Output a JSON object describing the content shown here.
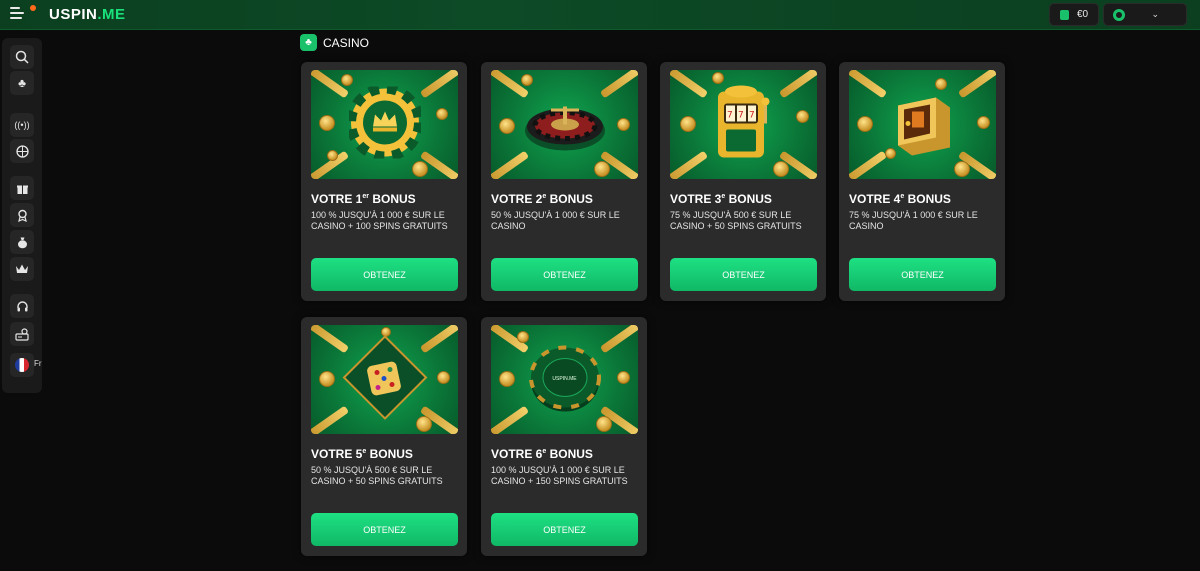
{
  "header": {
    "logo_main": "USPIN",
    "logo_accent": ".ME",
    "balance": "€0",
    "icons": {
      "menu": "hamburger-icon",
      "wallet": "wallet-icon",
      "profile": "user-icon",
      "chevron": "chevron-down-icon"
    }
  },
  "sidebar": {
    "icons": [
      "search-icon",
      "club-icon",
      "broadcast-icon",
      "basketball-icon",
      "gift-icon",
      "medal-icon",
      "money-bag-icon",
      "crown-icon",
      "headset-icon",
      "cashier-icon"
    ],
    "language_label": "Fr"
  },
  "section": {
    "title": "CASINO",
    "icon": "club-icon"
  },
  "cards": [
    {
      "title_prefix": "VOTRE 1",
      "title_sup": "er",
      "title_suffix": " BONUS",
      "description": "100 % JUSQU'À 1 000 € SUR LE CASINO + 100 SPINS GRATUITS",
      "button": "OBTENEZ",
      "image": "chip-crown"
    },
    {
      "title_prefix": "VOTRE 2",
      "title_sup": "e",
      "title_suffix": " BONUS",
      "description": "50 % JUSQU'À 1 000 € SUR LE CASINO",
      "button": "OBTENEZ",
      "image": "roulette"
    },
    {
      "title_prefix": "VOTRE 3",
      "title_sup": "e",
      "title_suffix": " BONUS",
      "description": "75 % JUSQU'À 500 € SUR LE CASINO + 50 SPINS GRATUITS",
      "button": "OBTENEZ",
      "image": "slot-machine"
    },
    {
      "title_prefix": "VOTRE 4",
      "title_sup": "e",
      "title_suffix": " BONUS",
      "description": "75 % JUSQU'À 1 000 € SUR LE CASINO",
      "button": "OBTENEZ",
      "image": "safe"
    },
    {
      "title_prefix": "VOTRE 5",
      "title_sup": "e",
      "title_suffix": " BONUS",
      "description": "50 % JUSQU'À 500 € SUR LE CASINO + 50 SPINS GRATUITS",
      "button": "OBTENEZ",
      "image": "dice"
    },
    {
      "title_prefix": "VOTRE 6",
      "title_sup": "e",
      "title_suffix": " BONUS",
      "description": "100 % JUSQU'À 1 000 € SUR LE CASINO + 150 SPINS GRATUITS",
      "button": "OBTENEZ",
      "image": "chip-logo",
      "image_text": "USPIN.ME"
    }
  ],
  "colors": {
    "accent": "#19c26a",
    "button": "#16d074",
    "card_bg": "#2b2b2b",
    "page_bg": "#0b0b0b",
    "header_bg": "#0d4a26"
  }
}
